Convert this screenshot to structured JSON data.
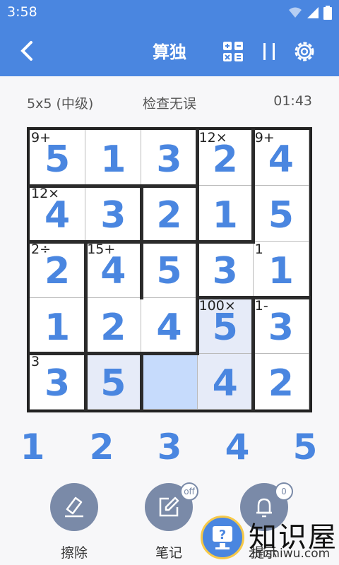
{
  "status_bar": {
    "time": "3:58",
    "icons": [
      "wifi-icon",
      "signal-icon",
      "battery-icon"
    ]
  },
  "app_bar": {
    "title": "算独",
    "back_icon": "back-arrow-icon",
    "calc_icon": "calculator-icon",
    "pause_icon": "pause-icon",
    "settings_icon": "gear-icon"
  },
  "info": {
    "size": "5x5 (中级)",
    "status": "检查无误",
    "timer": "01:43"
  },
  "puzzle": {
    "values": [
      [
        "5",
        "1",
        "3",
        "2",
        "4"
      ],
      [
        "4",
        "3",
        "2",
        "1",
        "5"
      ],
      [
        "2",
        "4",
        "5",
        "3",
        "1"
      ],
      [
        "1",
        "2",
        "4",
        "5",
        "3"
      ],
      [
        "3",
        "5",
        "",
        "4",
        "2"
      ]
    ],
    "cage_labels": {
      "r0c0": "9+",
      "r0c3": "12×",
      "r0c4": "9+",
      "r1c0": "12×",
      "r2c0": "2÷",
      "r2c1": "15+",
      "r2c4": "1",
      "r3c3": "100×",
      "r3c4": "1-",
      "r4c0": "3"
    }
  },
  "numpad": [
    "1",
    "2",
    "3",
    "4",
    "5"
  ],
  "tools": {
    "erase_label": "擦除",
    "notes_label": "笔记",
    "notes_badge": "off",
    "hint_label": "提示",
    "hint_badge": "0"
  },
  "watermark": {
    "text": "知识屋",
    "url": "zhishiwu.com"
  },
  "colors": {
    "primary": "#4a86e0",
    "highlight": "#e6ebf8",
    "selected": "#c6dbfc",
    "tool": "#7a8aa8"
  }
}
